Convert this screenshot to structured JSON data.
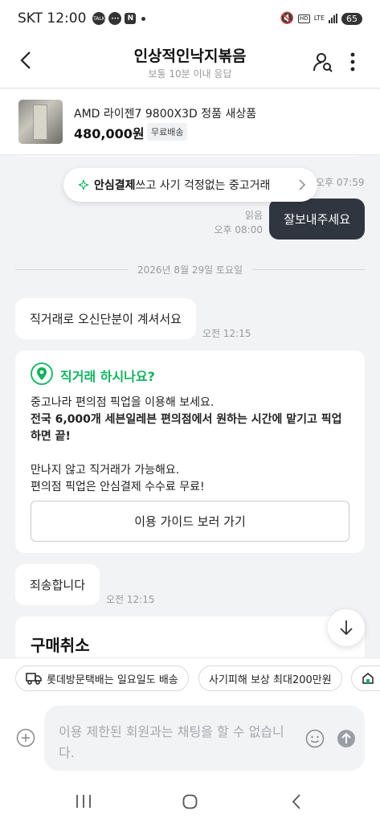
{
  "status_bar": {
    "carrier_time": "SKT 12:00",
    "app_icons": [
      "talk-icon",
      "chat-icon",
      "n-icon"
    ],
    "hd_label": "HD",
    "lte_label": "LTE",
    "battery": "65"
  },
  "header": {
    "title": "인상적인낙지볶음",
    "subtitle": "보통 10분 이내 응답"
  },
  "product": {
    "name": "AMD 라이젠7 9800X3D 정품 새상품",
    "price": "480,000원",
    "shipping": "무료배송"
  },
  "chat": {
    "safe_pay_bold": "안심결제",
    "safe_pay_rest": "쓰고 사기 걱정없는 중고거래",
    "behind_timestamp": "오후 07:59",
    "outgoing": {
      "read_label": "읽음",
      "time": "오후 08:00",
      "text": "잘보내주세요"
    },
    "date_divider": "2026년 8월 29일 토요일",
    "msg1": {
      "text": "직거래로 오신단분이 계셔서요",
      "time": "오전 12:15"
    },
    "card": {
      "title": "직거래 하시나요?",
      "line1": "중고나라 편의점 픽업을 이용해 보세요.",
      "line2_bold": "전국 6,000개 세븐일레븐 편의점에서 원하는 시간에 맡기고 픽업하면 끝!",
      "line3": "만나지 않고 직거래가 가능해요.",
      "line4": "편의점 픽업은 안심결제 수수료 무료!",
      "button": "이용 가이드 보러 가기"
    },
    "msg2": {
      "text": "죄송합니다",
      "time": "오전 12:15"
    },
    "cancel_title": "구매취소"
  },
  "chips": [
    {
      "label": "롯데방문택배는 일요일도 배송",
      "icon": "truck-icon"
    },
    {
      "label": "사기피해 보상 최대200만원"
    },
    {
      "label": "",
      "icon": "store-icon"
    }
  ],
  "input": {
    "placeholder": "이용 제한된 회원과는 채팅을 할 수 없습니다."
  },
  "colors": {
    "accent_green": "#13b35f",
    "outgoing_bubble": "#2f3640",
    "background": "#f2f3f5"
  }
}
